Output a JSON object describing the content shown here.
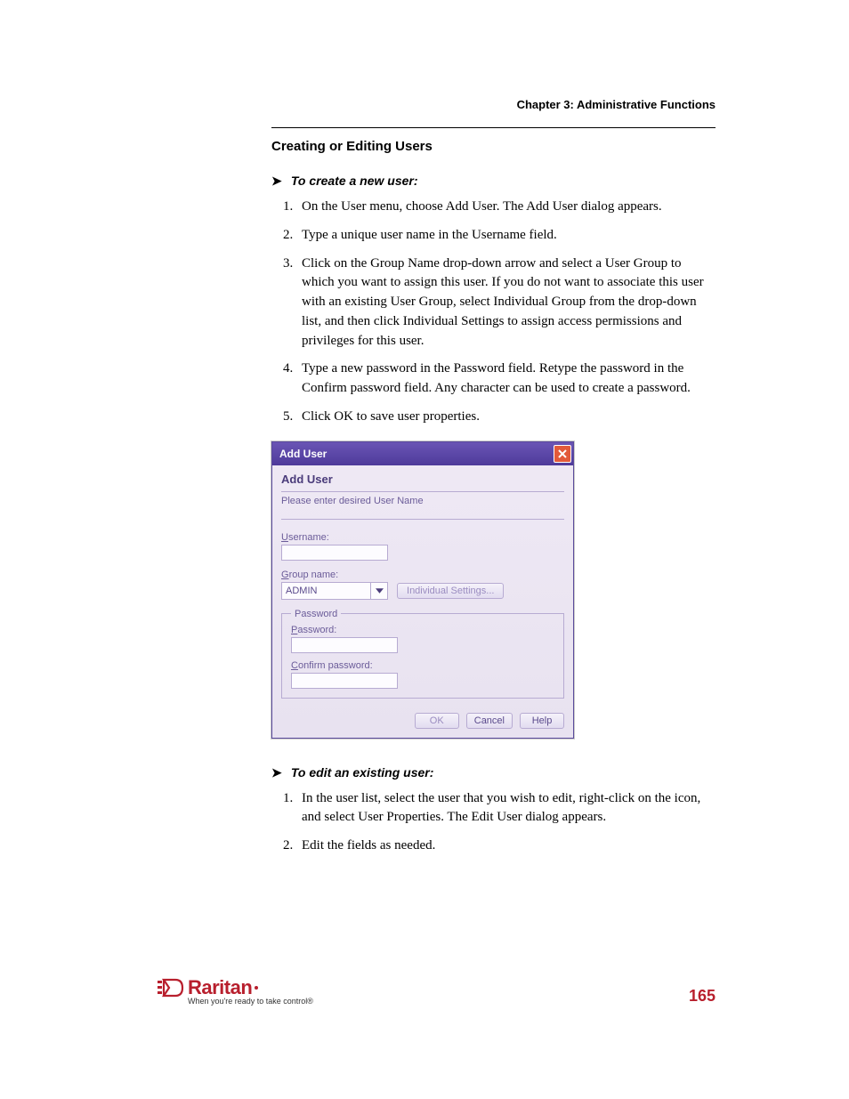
{
  "chapter": "Chapter 3: Administrative Functions",
  "section_title": "Creating or Editing Users",
  "proc_create": {
    "header": "To create a new user:",
    "steps": [
      "On the User menu, choose Add User. The Add User dialog appears.",
      "Type a unique user name in the Username field.",
      "Click on the Group Name drop-down arrow and select a User Group to which you want to assign this user. If you do not want to associate this user with an existing User Group, select Individual Group from the drop-down list, and then click Individual Settings to assign access permissions and privileges for this user.",
      "Type a new password in the Password field. Retype the password in the Confirm password field. Any character can be used to create a password.",
      "Click OK to save user properties."
    ]
  },
  "dialog": {
    "title": "Add User",
    "heading": "Add User",
    "instruction": "Please enter desired User Name",
    "username_label": "Username:",
    "username_value": "",
    "groupname_label": "Group name:",
    "group_selected": "ADMIN",
    "individual_settings": "Individual Settings...",
    "password_legend": "Password",
    "password_label": "Password:",
    "password_value": "",
    "confirm_label": "Confirm password:",
    "confirm_value": "",
    "ok": "OK",
    "cancel": "Cancel",
    "help": "Help"
  },
  "proc_edit": {
    "header": "To edit an existing user:",
    "steps": [
      "In the user list, select the user that you wish to edit, right-click on the icon, and select User Properties. The Edit User dialog appears.",
      "Edit the fields as needed."
    ]
  },
  "footer": {
    "brand": "Raritan",
    "tagline": "When you're ready to take control®",
    "page": "165"
  }
}
